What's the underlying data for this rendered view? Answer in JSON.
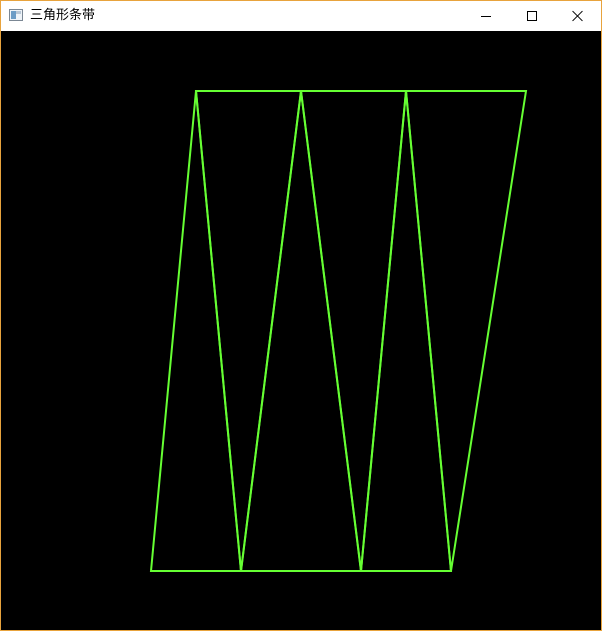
{
  "window": {
    "title": "三角形条带",
    "icon": "app-window-icon",
    "controls": {
      "minimize_icon": "minimize-icon",
      "maximize_icon": "maximize-icon",
      "close_icon": "close-icon"
    }
  },
  "canvas": {
    "background_color": "#000000",
    "stroke_color": "#66ff33",
    "primitive": "triangle-strip-wireframe",
    "triangle_count": 6,
    "vertex_count": 8
  }
}
